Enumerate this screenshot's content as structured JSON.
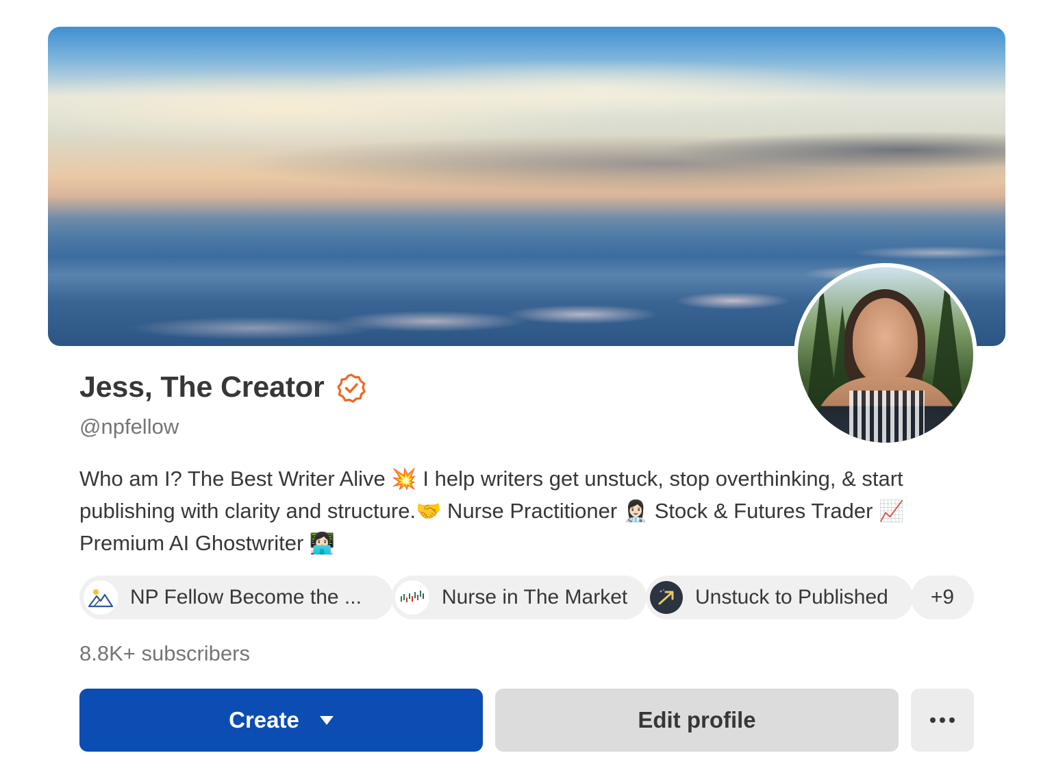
{
  "profile": {
    "name": "Jess, The Creator",
    "handle": "@npfellow",
    "bio": {
      "part1": "Who am I? The Best Writer Alive ",
      "emoji1": "💥",
      "part2": " I help writers get unstuck, stop overthinking, & start publishing with clarity and structure.",
      "emoji2": "🤝",
      "part3": " Nurse Practitioner ",
      "emoji3": "👩🏻‍⚕️",
      "part4": " Stock & Futures Trader ",
      "emoji4": "📈",
      "part5": " Premium AI Ghostwriter ",
      "emoji5": "👩🏻‍💻"
    },
    "subscribers": "8.8K+ subscribers",
    "verified_color": "#f26522"
  },
  "publications": [
    {
      "label": "NP Fellow Become the ...",
      "icon": "mountain-logo-icon"
    },
    {
      "label": "Nurse in The Market",
      "icon": "market-chart-logo-icon"
    },
    {
      "label": "Unstuck to Published",
      "icon": "arrow-up-logo-icon"
    }
  ],
  "publications_more": "+9",
  "actions": {
    "create_label": "Create",
    "edit_label": "Edit profile"
  },
  "colors": {
    "primary_button": "#0b4db3",
    "secondary_button": "#dcdcdc"
  }
}
